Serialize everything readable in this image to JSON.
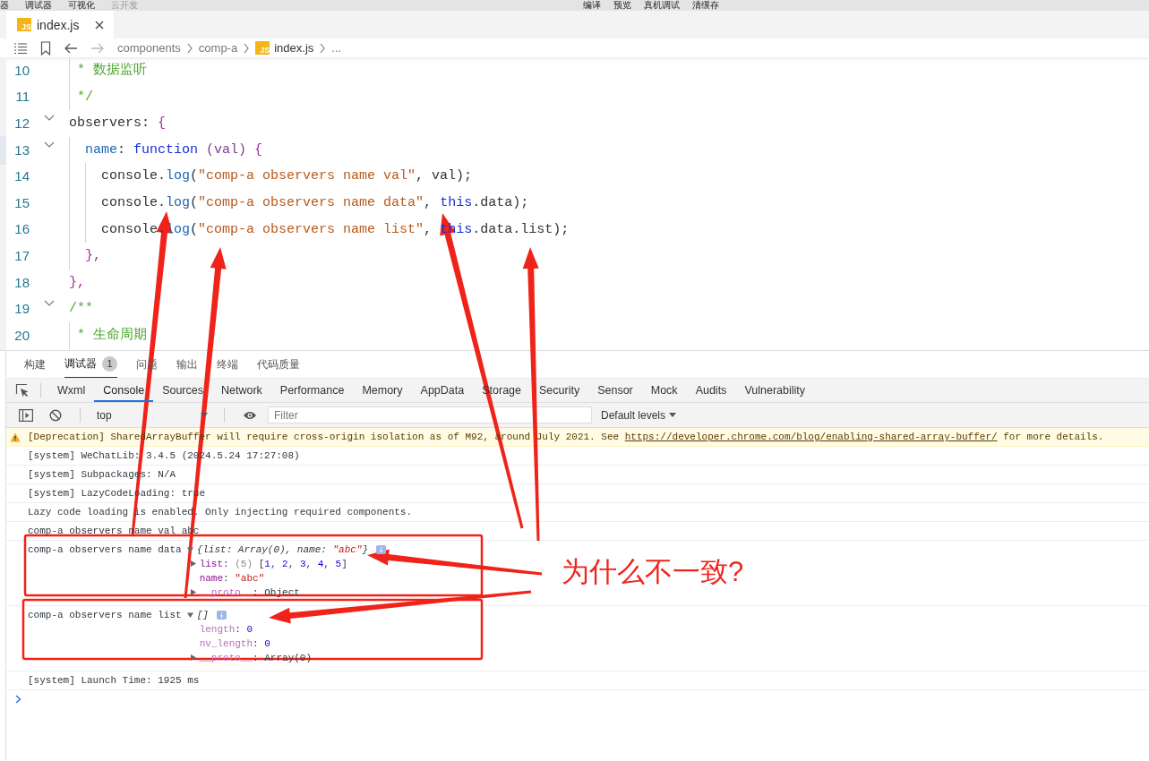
{
  "toolbar": {
    "left_items": [
      {
        "label": "器",
        "disabled": false
      },
      {
        "label": "调试器",
        "disabled": false
      },
      {
        "label": "可视化",
        "disabled": false
      },
      {
        "label": "云开发",
        "disabled": true
      }
    ],
    "right_items": [
      "编译",
      "预览",
      "真机调试",
      "清缓存"
    ]
  },
  "editor_tab": {
    "icon_text": "JS",
    "label": "index.js",
    "selected": true
  },
  "breadcrumb": {
    "forward_disabled": true,
    "parts": [
      {
        "label": "components",
        "kind": "folder"
      },
      {
        "label": "comp-a",
        "kind": "folder"
      },
      {
        "label": "index.js",
        "kind": "file",
        "icon_text": "JS"
      },
      {
        "label": "...",
        "kind": "more"
      }
    ]
  },
  "code_lines": [
    {
      "number": "10",
      "foldable": false,
      "tokens": [
        {
          "t": " * 数据监听",
          "kind": "comment"
        }
      ]
    },
    {
      "number": "11",
      "foldable": false,
      "tokens": [
        {
          "t": " */",
          "kind": "comment"
        }
      ]
    },
    {
      "number": "12",
      "foldable": true,
      "tokens": [
        {
          "t": "observers: ",
          "kind": "plain"
        },
        {
          "t": "{",
          "kind": "bracket"
        }
      ]
    },
    {
      "number": "13",
      "foldable": true,
      "tokens": [
        {
          "t": "  name",
          "kind": "prop"
        },
        {
          "t": ": ",
          "kind": "plain"
        },
        {
          "t": "function",
          "kind": "keyword"
        },
        {
          "t": " (val)",
          "kind": "paren"
        },
        {
          "t": " {",
          "kind": "bracket"
        }
      ]
    },
    {
      "number": "14",
      "foldable": false,
      "tokens": [
        {
          "t": "    console.",
          "kind": "plain"
        },
        {
          "t": "log",
          "kind": "method"
        },
        {
          "t": "(",
          "kind": "plain"
        },
        {
          "t": "\"comp-a observers name val\"",
          "kind": "string"
        },
        {
          "t": ", val);",
          "kind": "plain"
        }
      ]
    },
    {
      "number": "15",
      "foldable": false,
      "tokens": [
        {
          "t": "    console.",
          "kind": "plain"
        },
        {
          "t": "log",
          "kind": "method"
        },
        {
          "t": "(",
          "kind": "plain"
        },
        {
          "t": "\"comp-a observers name data\"",
          "kind": "string"
        },
        {
          "t": ", ",
          "kind": "plain"
        },
        {
          "t": "this",
          "kind": "keyword"
        },
        {
          "t": ".data);",
          "kind": "plain"
        }
      ]
    },
    {
      "number": "16",
      "foldable": false,
      "tokens": [
        {
          "t": "    console.",
          "kind": "plain"
        },
        {
          "t": "log",
          "kind": "method"
        },
        {
          "t": "(",
          "kind": "plain"
        },
        {
          "t": "\"comp-a observers name list\"",
          "kind": "string"
        },
        {
          "t": ", ",
          "kind": "plain"
        },
        {
          "t": "this",
          "kind": "keyword"
        },
        {
          "t": ".data.list);",
          "kind": "plain"
        }
      ]
    },
    {
      "number": "17",
      "foldable": false,
      "tokens": [
        {
          "t": "  },",
          "kind": "bracket"
        }
      ]
    },
    {
      "number": "18",
      "foldable": false,
      "tokens": [
        {
          "t": "},",
          "kind": "bracket"
        }
      ]
    },
    {
      "number": "19",
      "foldable": true,
      "tokens": [
        {
          "t": "/**",
          "kind": "comment"
        }
      ]
    },
    {
      "number": "20",
      "foldable": false,
      "tokens": [
        {
          "t": " * 生命周期",
          "kind": "comment"
        }
      ]
    }
  ],
  "panel_tabs": [
    {
      "label": "构建",
      "selected": false
    },
    {
      "label": "调试器",
      "selected": true,
      "badge": "1"
    },
    {
      "label": "问题",
      "selected": false
    },
    {
      "label": "输出",
      "selected": false
    },
    {
      "label": "终端",
      "selected": false
    },
    {
      "label": "代码质量",
      "selected": false
    }
  ],
  "devtools_tabs": [
    {
      "label": "Wxml",
      "selected": false
    },
    {
      "label": "Console",
      "selected": true
    },
    {
      "label": "Sources",
      "selected": false
    },
    {
      "label": "Network",
      "selected": false
    },
    {
      "label": "Performance",
      "selected": false
    },
    {
      "label": "Memory",
      "selected": false
    },
    {
      "label": "AppData",
      "selected": false
    },
    {
      "label": "Storage",
      "selected": false
    },
    {
      "label": "Security",
      "selected": false
    },
    {
      "label": "Sensor",
      "selected": false
    },
    {
      "label": "Mock",
      "selected": false
    },
    {
      "label": "Audits",
      "selected": false
    },
    {
      "label": "Vulnerability",
      "selected": false
    }
  ],
  "console_toolbar": {
    "context": "top",
    "filter_placeholder": "Filter",
    "levels": "Default levels"
  },
  "console_messages": [
    {
      "kind": "warning",
      "text": "[Deprecation] SharedArrayBuffer will require cross-origin isolation as of M92, around July 2021. See ",
      "link": "https://developer.chrome.com/blog/enabling-shared-array-buffer/",
      "tail": " for more details."
    },
    {
      "kind": "log",
      "text": "[system] WeChatLib: 3.4.5 (2024.5.24 17:27:08)"
    },
    {
      "kind": "log",
      "text": "[system] Subpackages: N/A"
    },
    {
      "kind": "log",
      "text": "[system] LazyCodeLoading: true"
    },
    {
      "kind": "log",
      "text": "Lazy code loading is enabled. Only injecting required components."
    },
    {
      "kind": "log",
      "text": "comp-a observers name val abc"
    },
    {
      "kind": "object",
      "text": "comp-a observers name data",
      "expanded": true,
      "preview": [
        {
          "t": "{list: Array(0), name: ",
          "kind": "plain"
        },
        {
          "t": "\"abc\"",
          "kind": "string"
        },
        {
          "t": "}",
          "kind": "plain"
        }
      ],
      "props": [
        {
          "key": "list",
          "expandable": true,
          "expanded": false,
          "dim": false,
          "value": [
            {
              "t": ": ",
              "kind": "plain"
            },
            {
              "t": "(5) ",
              "kind": "dim"
            },
            {
              "t": "[",
              "kind": "plain"
            },
            {
              "t": "1",
              "kind": "number"
            },
            {
              "t": ", ",
              "kind": "plain"
            },
            {
              "t": "2",
              "kind": "number"
            },
            {
              "t": ", ",
              "kind": "plain"
            },
            {
              "t": "3",
              "kind": "number"
            },
            {
              "t": ", ",
              "kind": "plain"
            },
            {
              "t": "4",
              "kind": "number"
            },
            {
              "t": ", ",
              "kind": "plain"
            },
            {
              "t": "5",
              "kind": "number"
            },
            {
              "t": "]",
              "kind": "plain"
            }
          ]
        },
        {
          "key": "name",
          "expandable": false,
          "dim": false,
          "value": [
            {
              "t": ": ",
              "kind": "plain"
            },
            {
              "t": "\"abc\"",
              "kind": "string"
            }
          ]
        },
        {
          "key": "__proto__",
          "expandable": true,
          "expanded": false,
          "dim": true,
          "value": [
            {
              "t": ": Object",
              "kind": "plain"
            }
          ]
        }
      ]
    },
    {
      "kind": "object",
      "text": "comp-a observers name list",
      "expanded": true,
      "preview": [
        {
          "t": "[]",
          "kind": "plain"
        }
      ],
      "props": [
        {
          "key": "length",
          "expandable": false,
          "dim": true,
          "value": [
            {
              "t": ": ",
              "kind": "plain"
            },
            {
              "t": "0",
              "kind": "number"
            }
          ]
        },
        {
          "key": "nv_length",
          "expandable": false,
          "dim": true,
          "value": [
            {
              "t": ": ",
              "kind": "plain"
            },
            {
              "t": "0",
              "kind": "number"
            }
          ]
        },
        {
          "key": "__proto__",
          "expandable": true,
          "expanded": false,
          "dim": true,
          "value": [
            {
              "t": ": Array(0)",
              "kind": "plain"
            }
          ]
        }
      ]
    },
    {
      "kind": "log",
      "text": "[system] Launch Time: 1925 ms"
    }
  ],
  "annotation": {
    "text": "为什么不一致?"
  }
}
